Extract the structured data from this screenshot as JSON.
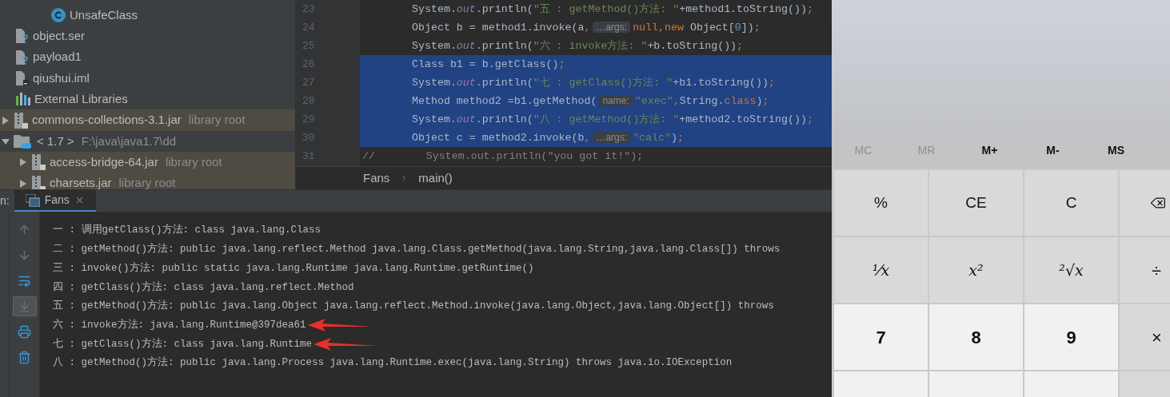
{
  "project_tree": {
    "items": [
      {
        "kind": "class",
        "label": "UnsafeClass"
      },
      {
        "kind": "unknown_file",
        "label": "object.ser"
      },
      {
        "kind": "unknown_file",
        "label": "payload1"
      },
      {
        "kind": "module_file",
        "label": "qiushui.iml"
      },
      {
        "kind": "libraries",
        "label": "External Libraries",
        "children": [
          {
            "kind": "jar",
            "label": "commons-collections-3.1.jar",
            "suffix": "library root",
            "expanded": false,
            "highlighted": true
          },
          {
            "kind": "sdk",
            "label": "< 1.7 >",
            "suffix": "F:\\java\\java1.7\\dd",
            "expanded": true,
            "highlighted": false,
            "children": [
              {
                "kind": "jar",
                "label": "access-bridge-64.jar",
                "suffix": "library root",
                "expanded": false,
                "highlighted": true
              },
              {
                "kind": "jar",
                "label": "charsets.jar",
                "suffix": "library root",
                "expanded": false,
                "highlighted": true
              }
            ]
          }
        ]
      }
    ]
  },
  "editor": {
    "lines": [
      {
        "number": "23",
        "selected": false,
        "segments": [
          {
            "kind": "plain",
            "text": "System."
          },
          {
            "kind": "field",
            "text": "out"
          },
          {
            "kind": "plain",
            "text": ".println("
          },
          {
            "kind": "string",
            "text": "\"五 : getMethod()方法: \""
          },
          {
            "kind": "plain",
            "text": "+method1.toString())"
          },
          {
            "kind": "keyword",
            "text": ";"
          }
        ]
      },
      {
        "number": "24",
        "selected": false,
        "segments": [
          {
            "kind": "plain",
            "text": "Object b = method1.invoke(a"
          },
          {
            "kind": "keyword",
            "text": ","
          },
          {
            "kind": "hint",
            "text": "…args:"
          },
          {
            "kind": "keyword",
            "text": "null,new"
          },
          {
            "kind": "plain",
            "text": " Object["
          },
          {
            "kind": "number",
            "text": "0"
          },
          {
            "kind": "plain",
            "text": "])"
          },
          {
            "kind": "keyword",
            "text": ";"
          }
        ]
      },
      {
        "number": "25",
        "selected": false,
        "segments": [
          {
            "kind": "plain",
            "text": "System."
          },
          {
            "kind": "field",
            "text": "out"
          },
          {
            "kind": "plain",
            "text": ".println("
          },
          {
            "kind": "string",
            "text": "\"六 : invoke方法: \""
          },
          {
            "kind": "plain",
            "text": "+b.toString())"
          },
          {
            "kind": "keyword",
            "text": ";"
          }
        ]
      },
      {
        "number": "26",
        "selected": true,
        "segments": [
          {
            "kind": "plain",
            "text": "Class b1 = b.getClass()"
          },
          {
            "kind": "keyword",
            "text": ";"
          }
        ]
      },
      {
        "number": "27",
        "selected": true,
        "segments": [
          {
            "kind": "plain",
            "text": "System."
          },
          {
            "kind": "field",
            "text": "out"
          },
          {
            "kind": "plain",
            "text": ".println("
          },
          {
            "kind": "string",
            "text": "\"七 : getClass()方法: \""
          },
          {
            "kind": "plain",
            "text": "+b1.toString())"
          },
          {
            "kind": "keyword",
            "text": ";"
          }
        ]
      },
      {
        "number": "28",
        "selected": true,
        "segments": [
          {
            "kind": "plain",
            "text": "Method method2 =b1.getMethod("
          },
          {
            "kind": "hint",
            "text": "name:"
          },
          {
            "kind": "string",
            "text": "\"exec\""
          },
          {
            "kind": "keyword",
            "text": ","
          },
          {
            "kind": "plain",
            "text": "String."
          },
          {
            "kind": "keyword",
            "text": "class"
          },
          {
            "kind": "plain",
            "text": ")"
          },
          {
            "kind": "keyword",
            "text": ";"
          }
        ]
      },
      {
        "number": "29",
        "selected": true,
        "segments": [
          {
            "kind": "plain",
            "text": "System."
          },
          {
            "kind": "field",
            "text": "out"
          },
          {
            "kind": "plain",
            "text": ".println("
          },
          {
            "kind": "string",
            "text": "\"八 : getMethod()方法: \""
          },
          {
            "kind": "plain",
            "text": "+method2.toString())"
          },
          {
            "kind": "keyword",
            "text": ";"
          }
        ]
      },
      {
        "number": "30",
        "selected": true,
        "segments": [
          {
            "kind": "plain",
            "text": "Object c = method2.invoke(b"
          },
          {
            "kind": "keyword",
            "text": ","
          },
          {
            "kind": "hint",
            "text": "…args:"
          },
          {
            "kind": "string",
            "text": "\"calc\""
          },
          {
            "kind": "plain",
            "text": ")"
          },
          {
            "kind": "keyword",
            "text": ";"
          }
        ]
      },
      {
        "number": "31",
        "selected": false,
        "segments": [
          {
            "kind": "comment",
            "text": "//        System.out.println(\"you got it!\");"
          }
        ]
      }
    ],
    "breadcrumbs": [
      "Fans",
      "main()"
    ]
  },
  "run_panel": {
    "label": "n:",
    "tab": {
      "title": "Fans",
      "selected": true
    },
    "toolbar": [
      {
        "kind": "up",
        "selected": false
      },
      {
        "kind": "down",
        "selected": false
      },
      {
        "kind": "wrap",
        "selected": false
      },
      {
        "kind": "scroll_end",
        "selected": true
      },
      {
        "kind": "print",
        "selected": false
      },
      {
        "kind": "trash",
        "selected": false
      }
    ],
    "console": [
      {
        "text": "一 : 调用getClass()方法: class java.lang.Class",
        "marked": false
      },
      {
        "text": "二 : getMethod()方法: public java.lang.reflect.Method java.lang.Class.getMethod(java.lang.String,java.lang.Class[]) throws",
        "marked": false
      },
      {
        "text": "三 : invoke()方法: public static java.lang.Runtime java.lang.Runtime.getRuntime()",
        "marked": false
      },
      {
        "text": "四 : getClass()方法: class java.lang.reflect.Method",
        "marked": false
      },
      {
        "text": "五 : getMethod()方法: public java.lang.Object java.lang.reflect.Method.invoke(java.lang.Object,java.lang.Object[]) throws",
        "marked": false
      },
      {
        "text": "六 : invoke方法: java.lang.Runtime@397dea61",
        "marked": true
      },
      {
        "text": "七 : getClass()方法: class java.lang.Runtime",
        "marked": true
      },
      {
        "text": "八 : getMethod()方法: public java.lang.Process java.lang.Runtime.exec(java.lang.String) throws java.io.IOException",
        "marked": false
      }
    ]
  },
  "calculator": {
    "memory": [
      {
        "label": "MC",
        "disabled": true
      },
      {
        "label": "MR",
        "disabled": true
      },
      {
        "label": "M+",
        "disabled": false
      },
      {
        "label": "M-",
        "disabled": false
      },
      {
        "label": "MS",
        "disabled": false
      }
    ],
    "keys": [
      {
        "kind": "function",
        "label": "%"
      },
      {
        "kind": "function",
        "label": "CE"
      },
      {
        "kind": "function",
        "label": "C"
      },
      {
        "kind": "backspace"
      },
      {
        "kind": "math",
        "label": "¹⁄x"
      },
      {
        "kind": "math",
        "label": "x²"
      },
      {
        "kind": "math",
        "label": "²√x"
      },
      {
        "kind": "operator",
        "label": "÷"
      },
      {
        "kind": "digit",
        "label": "7"
      },
      {
        "kind": "digit",
        "label": "8"
      },
      {
        "kind": "digit",
        "label": "9"
      },
      {
        "kind": "operator",
        "label": "×"
      },
      {
        "kind": "digit"
      },
      {
        "kind": "digit"
      },
      {
        "kind": "digit"
      },
      {
        "kind": "operator"
      }
    ]
  }
}
